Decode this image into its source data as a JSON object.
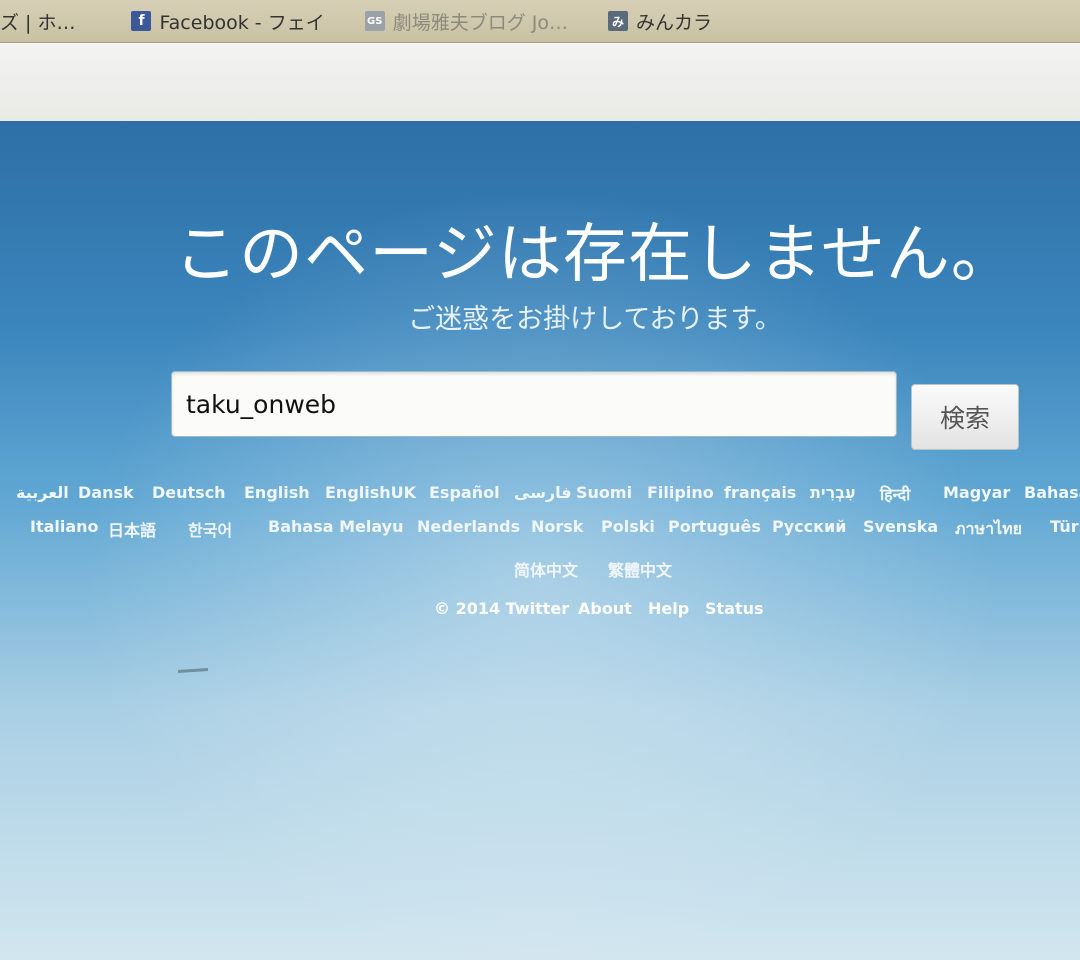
{
  "bookmarks": [
    {
      "label": "ズ | ホ…",
      "icon": "",
      "faded": false
    },
    {
      "label": "Facebook - フェイ",
      "icon": "f",
      "faded": false
    },
    {
      "label": "劇場雅夫ブログ Jo…",
      "icon": "GS",
      "faded": true
    },
    {
      "label": "みんカラ",
      "icon": "み",
      "faded": false
    }
  ],
  "page": {
    "title": "このページは存在しません。",
    "subtitle": "ご迷惑をお掛けしております。"
  },
  "search": {
    "value": "taku_onweb",
    "button_label": "検索"
  },
  "languages_row1": [
    "العربية",
    "Dansk",
    "Deutsch",
    "English",
    "EnglishUK",
    "Español",
    "فارسی",
    "Suomi",
    "Filipino",
    "français",
    "עִבְרִית",
    "हिन्दी",
    "Magyar",
    "Bahasa"
  ],
  "languages_row2": [
    "Italiano",
    "日本語",
    "한국어",
    "Bahasa Melayu",
    "Nederlands",
    "Norsk",
    "Polski",
    "Português",
    "Русский",
    "Svenska",
    "ภาษาไทย",
    "Türk"
  ],
  "languages_row3": [
    "简体中文",
    "繁體中文"
  ],
  "footer": {
    "copyright": "© 2014 Twitter",
    "about": "About",
    "help": "Help",
    "status": "Status"
  },
  "colors": {
    "background_top": "#2d6fa6",
    "background_bottom": "#d2e6ef",
    "text": "#ffffff"
  }
}
